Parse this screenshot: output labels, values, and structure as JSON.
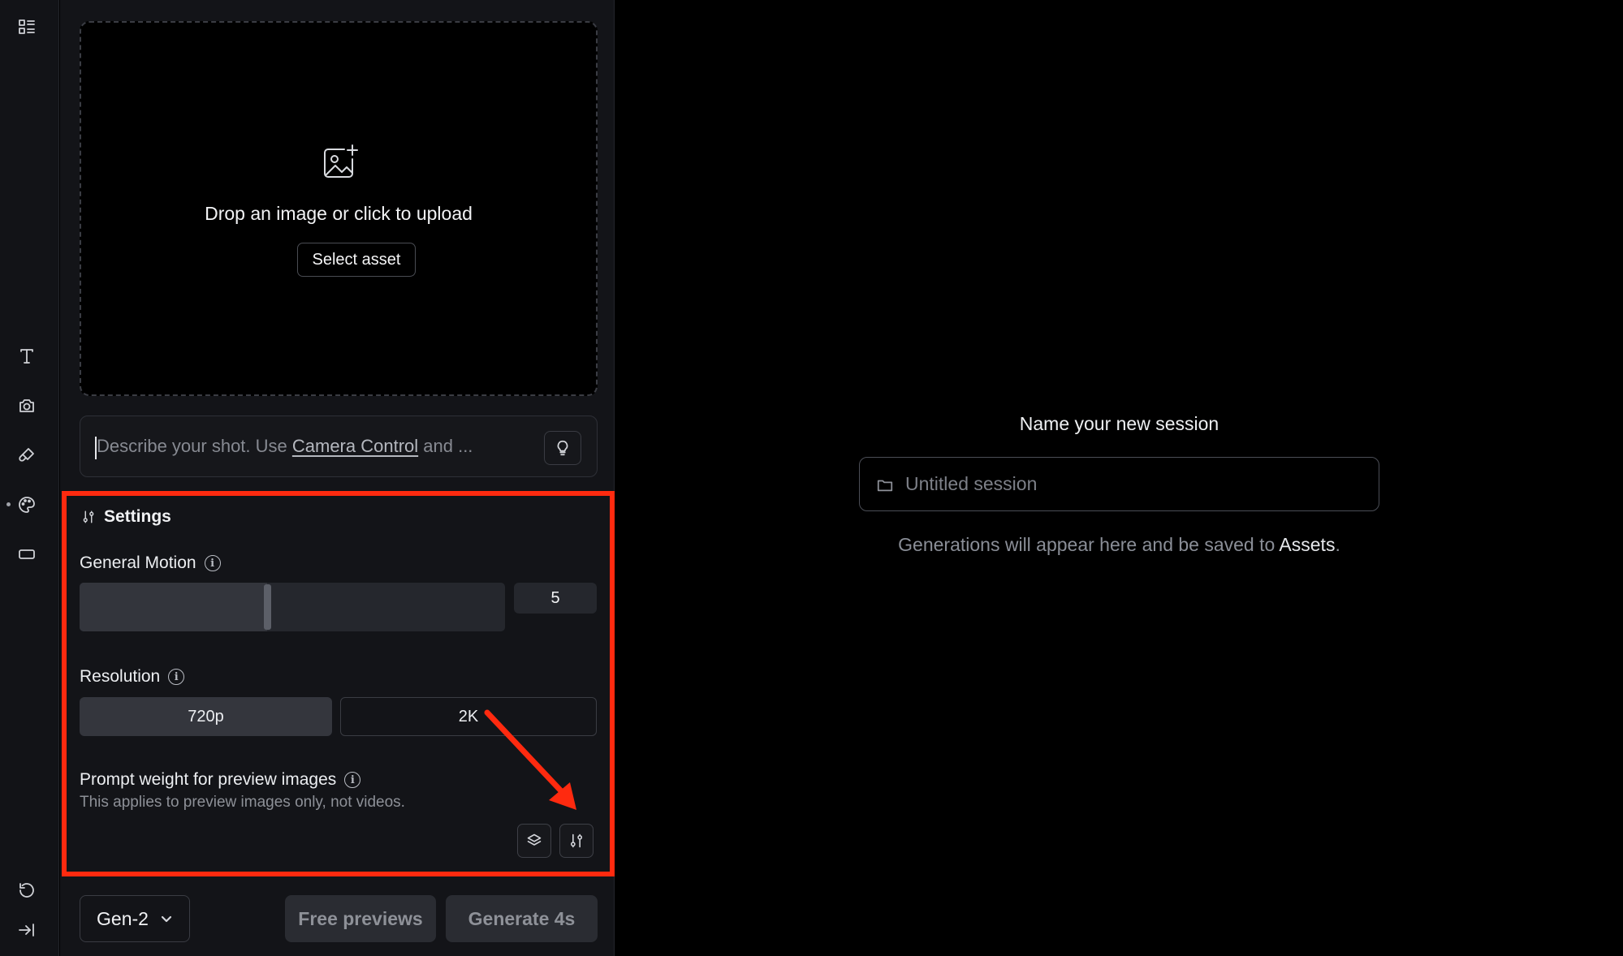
{
  "rail": {
    "icons": [
      "sidebar-menu-icon",
      "text-icon",
      "camera-icon",
      "brush-icon",
      "palette-icon",
      "aspect-ratio-icon",
      "undo-icon",
      "collapse-panel-icon"
    ]
  },
  "upload": {
    "text": "Drop an image or click to upload",
    "button_label": "Select asset"
  },
  "prompt": {
    "text_before": "Describe your shot. Use ",
    "link_text": "Camera Control",
    "text_after": " and ..."
  },
  "settings": {
    "title": "Settings",
    "general_motion": {
      "label": "General Motion",
      "value": "5",
      "fraction": 0.44
    },
    "resolution": {
      "label": "Resolution",
      "options": [
        "720p",
        "2K"
      ],
      "selected": "720p"
    },
    "prompt_weight": {
      "label": "Prompt weight for preview images",
      "note": "This applies to preview images only, not videos."
    }
  },
  "footer": {
    "model": "Gen-2",
    "free_previews_label": "Free previews",
    "generate_label": "Generate 4s"
  },
  "session": {
    "heading": "Name your new session",
    "placeholder": "Untitled session",
    "hint_before": "Generations will appear here and be saved to ",
    "hint_link": "Assets",
    "hint_after": "."
  },
  "colors": {
    "highlight_frame": "#ff2a0f",
    "panel_bg": "#131418",
    "background": "#000000"
  }
}
